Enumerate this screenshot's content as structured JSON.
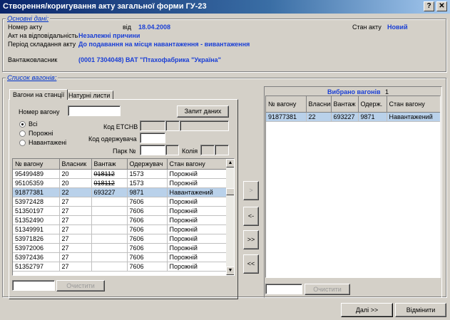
{
  "window": {
    "title": "Створення/коригування акту загальної форми ГУ-23",
    "help": "?",
    "close": "X"
  },
  "main_data": {
    "group_label": "Основні дані:",
    "act_number_label": "Номер акту",
    "from_label": "від",
    "date": "18.04.2008",
    "act_state_label": "Стан акту",
    "act_state": "Новий",
    "responsibility_label": "Акт на відповідальність",
    "responsibility": "Незалежні причини",
    "period_label": "Період складання акту",
    "period": "До подавання на місця навантаження - вивантаження",
    "shipper_label": "Вантажовласник",
    "shipper": "(0001 7304048) ВАТ \"Птахофабрика \"Україна\""
  },
  "wagons": {
    "group_label": "Список вагонів:",
    "tabs": [
      "Вагони на станції",
      "Натурні листи"
    ],
    "wagon_number_label": "Номер вагону",
    "request_button": "Запит даних",
    "radios": [
      "Всі",
      "Порожні",
      "Навантажені"
    ],
    "radio_selected": 0,
    "etsnv_label": "Код ЕТСНВ",
    "receiver_code_label": "Код одержувача",
    "park_label": "Парк №",
    "track_label": "Колія",
    "columns": [
      "№ вагону",
      "Власник",
      "Вантаж",
      "Одержувач",
      "Стан вагону"
    ],
    "rows": [
      [
        "95499489",
        "20",
        "018112",
        "1573",
        "Порожній"
      ],
      [
        "95105359",
        "20",
        "018112",
        "1573",
        "Порожній"
      ],
      [
        "91877381",
        "22",
        "693227",
        "9871",
        "Навантажений"
      ],
      [
        "53972428",
        "27",
        "",
        "7606",
        "Порожній"
      ],
      [
        "51350197",
        "27",
        "",
        "7606",
        "Порожній"
      ],
      [
        "51352490",
        "27",
        "",
        "7606",
        "Порожній"
      ],
      [
        "51349991",
        "27",
        "",
        "7606",
        "Порожній"
      ],
      [
        "53971826",
        "27",
        "",
        "7606",
        "Порожній"
      ],
      [
        "53972006",
        "27",
        "",
        "7606",
        "Порожній"
      ],
      [
        "53972436",
        "27",
        "",
        "7606",
        "Порожній"
      ],
      [
        "51352797",
        "27",
        "",
        "7606",
        "Порожній"
      ]
    ],
    "selected_row": 2,
    "strike_rows": [
      0,
      1
    ],
    "clear_button": "Очистити"
  },
  "transfer": {
    "add_one": ">",
    "remove_one": "<-",
    "add_all": ">>",
    "remove_all": "<<"
  },
  "selected": {
    "title": "Вибрано вагонів",
    "count": "1",
    "columns": [
      "№ вагону",
      "Власник",
      "Вантаж",
      "Одерж.",
      "Стан вагону"
    ],
    "rows": [
      [
        "91877381",
        "22",
        "693227",
        "9871",
        "Навантажений"
      ]
    ],
    "clear_button": "Очистити"
  },
  "footer": {
    "next_button": "Далі >>",
    "cancel_button": "Відмінити"
  },
  "colors": {
    "title_start": "#0a246a",
    "value_blue": "#1a3fd6",
    "selection": "#b9d1ea"
  }
}
